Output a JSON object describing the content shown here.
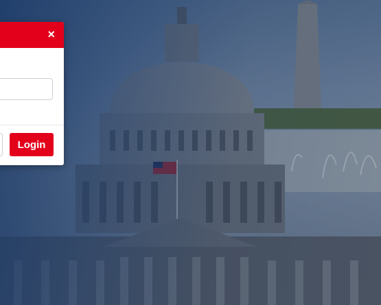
{
  "background": {
    "image": "us-capitol-building-and-washington-monument-photo"
  },
  "dialog": {
    "close_icon": "close-icon",
    "close_glyph": "×",
    "login_label": "Login"
  },
  "colors": {
    "accent": "#e3001b",
    "overlay": "#2c4a78"
  }
}
